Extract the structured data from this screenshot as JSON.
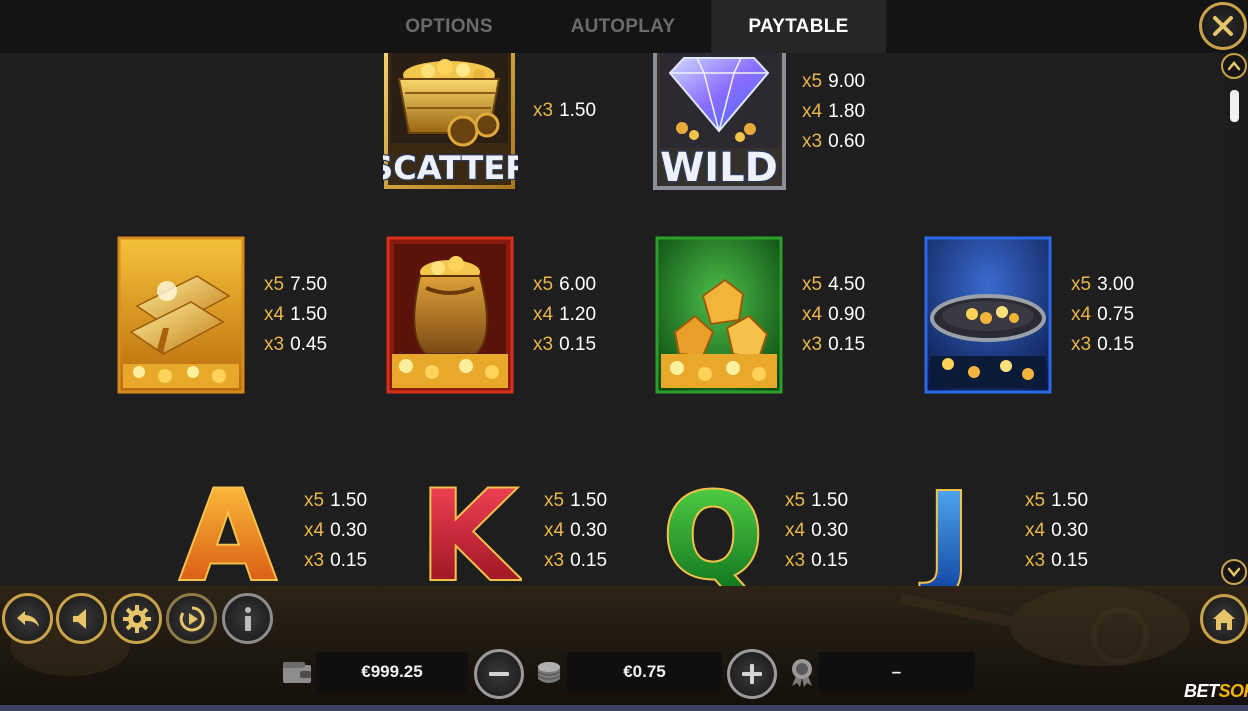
{
  "tabs": {
    "options": "OPTIONS",
    "autoplay": "AUTOPLAY",
    "paytable": "PAYTABLE",
    "active": "paytable"
  },
  "close_icon": "close-icon",
  "paytable": {
    "scatter": {
      "label": "SCATTER",
      "pays": [
        {
          "mult": "x3",
          "value": "1.50"
        }
      ]
    },
    "wild": {
      "label": "WILD",
      "pays": [
        {
          "mult": "x5",
          "value": "9.00"
        },
        {
          "mult": "x4",
          "value": "1.80"
        },
        {
          "mult": "x3",
          "value": "0.60"
        }
      ]
    },
    "gold_bars": {
      "pays": [
        {
          "mult": "x5",
          "value": "7.50"
        },
        {
          "mult": "x4",
          "value": "1.50"
        },
        {
          "mult": "x3",
          "value": "0.45"
        }
      ]
    },
    "gold_sack": {
      "pays": [
        {
          "mult": "x5",
          "value": "6.00"
        },
        {
          "mult": "x4",
          "value": "1.20"
        },
        {
          "mult": "x3",
          "value": "0.15"
        }
      ]
    },
    "gold_nuggets": {
      "pays": [
        {
          "mult": "x5",
          "value": "4.50"
        },
        {
          "mult": "x4",
          "value": "0.90"
        },
        {
          "mult": "x3",
          "value": "0.15"
        }
      ]
    },
    "gold_pan": {
      "pays": [
        {
          "mult": "x5",
          "value": "3.00"
        },
        {
          "mult": "x4",
          "value": "0.75"
        },
        {
          "mult": "x3",
          "value": "0.15"
        }
      ]
    },
    "ace": {
      "letter": "A",
      "pays": [
        {
          "mult": "x5",
          "value": "1.50"
        },
        {
          "mult": "x4",
          "value": "0.30"
        },
        {
          "mult": "x3",
          "value": "0.15"
        }
      ]
    },
    "king": {
      "letter": "K",
      "pays": [
        {
          "mult": "x5",
          "value": "1.50"
        },
        {
          "mult": "x4",
          "value": "0.30"
        },
        {
          "mult": "x3",
          "value": "0.15"
        }
      ]
    },
    "queen": {
      "letter": "Q",
      "pays": [
        {
          "mult": "x5",
          "value": "1.50"
        },
        {
          "mult": "x4",
          "value": "0.30"
        },
        {
          "mult": "x3",
          "value": "0.15"
        }
      ]
    },
    "jack": {
      "letter": "J",
      "pays": [
        {
          "mult": "x5",
          "value": "1.50"
        },
        {
          "mult": "x4",
          "value": "0.30"
        },
        {
          "mult": "x3",
          "value": "0.15"
        }
      ]
    }
  },
  "controls": {
    "buttons": [
      "back-icon",
      "sound-icon",
      "settings-icon",
      "autoplay-icon",
      "info-icon",
      "home-icon"
    ],
    "balance": "€999.25",
    "bet": "€0.75",
    "win": "–"
  },
  "brand": {
    "part1": "BET",
    "part2": "SOFT"
  },
  "colors": {
    "gold": "#c9a24a",
    "multiplier": "#e9b64a",
    "active_tab_bg": "#262626",
    "brand_yellow": "#f4b400"
  }
}
